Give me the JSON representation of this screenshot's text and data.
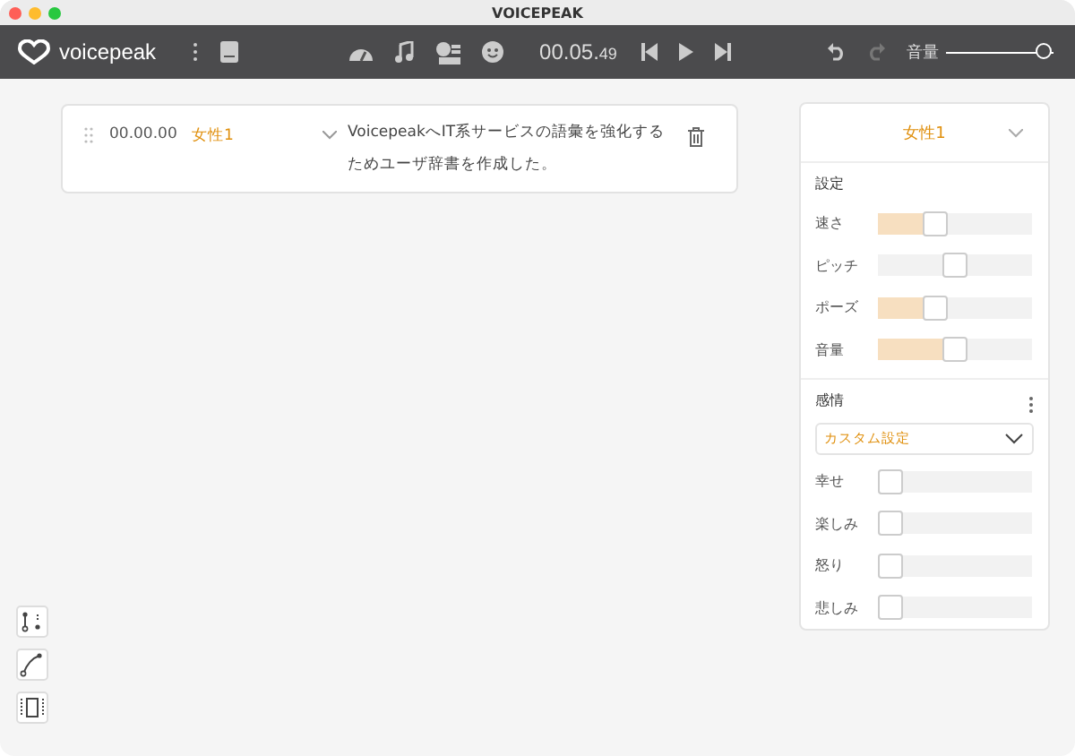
{
  "window": {
    "title": "VOICEPEAK"
  },
  "toolbar": {
    "logo": "voicepeak",
    "time_main": "00.05.",
    "time_frac": "49",
    "volume_label": "音量",
    "volume": {
      "level": 1
    }
  },
  "blocks": [
    {
      "time": "00.00.00",
      "narrator": "女性1",
      "text": "VoicepeakへIT系サービスの語彙を強化するためユーザ辞書を作成した。"
    }
  ],
  "panel": {
    "narrator": "女性1",
    "settings_title": "設定",
    "settings": [
      {
        "label": "速さ",
        "level": 0.35,
        "filled": true
      },
      {
        "label": "ピッチ",
        "level": 0.5,
        "filled": false
      },
      {
        "label": "ポーズ",
        "level": 0.35,
        "filled": true
      },
      {
        "label": "音量",
        "level": 0.5,
        "filled": true
      }
    ],
    "emotion_title": "感情",
    "emotion_preset": "カスタム設定",
    "emotions": [
      {
        "label": "幸せ",
        "level": 0
      },
      {
        "label": "楽しみ",
        "level": 0
      },
      {
        "label": "怒り",
        "level": 0
      },
      {
        "label": "悲しみ",
        "level": 0
      }
    ]
  }
}
